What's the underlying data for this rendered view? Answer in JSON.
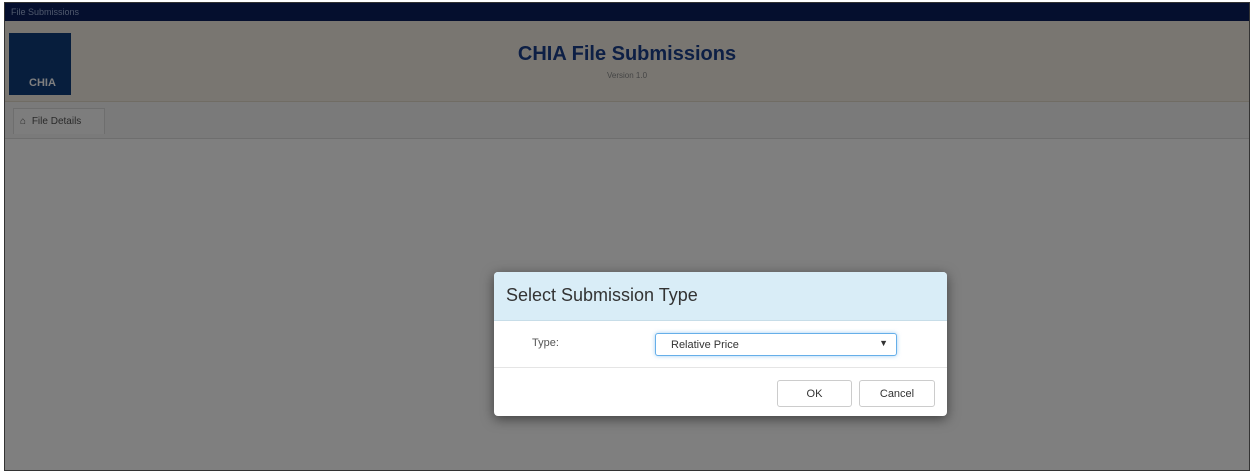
{
  "window": {
    "title": "File Submissions"
  },
  "header": {
    "logo_text": "CHIA",
    "app_title": "CHIA File Submissions",
    "version": "Version 1.0"
  },
  "nav": {
    "tabs": [
      {
        "label": "File Details",
        "icon": "home-icon"
      }
    ]
  },
  "modal": {
    "title": "Select Submission Type",
    "type_label": "Type:",
    "type_select": {
      "selected": "Relative Price"
    },
    "ok_label": "OK",
    "cancel_label": "Cancel"
  },
  "colors": {
    "titlebar": "#0a1f5c",
    "header_bg": "#f2ede3",
    "title_color": "#1a3f8a",
    "modal_header": "#d9edf7",
    "logo_bg": "#0f3c7a"
  }
}
